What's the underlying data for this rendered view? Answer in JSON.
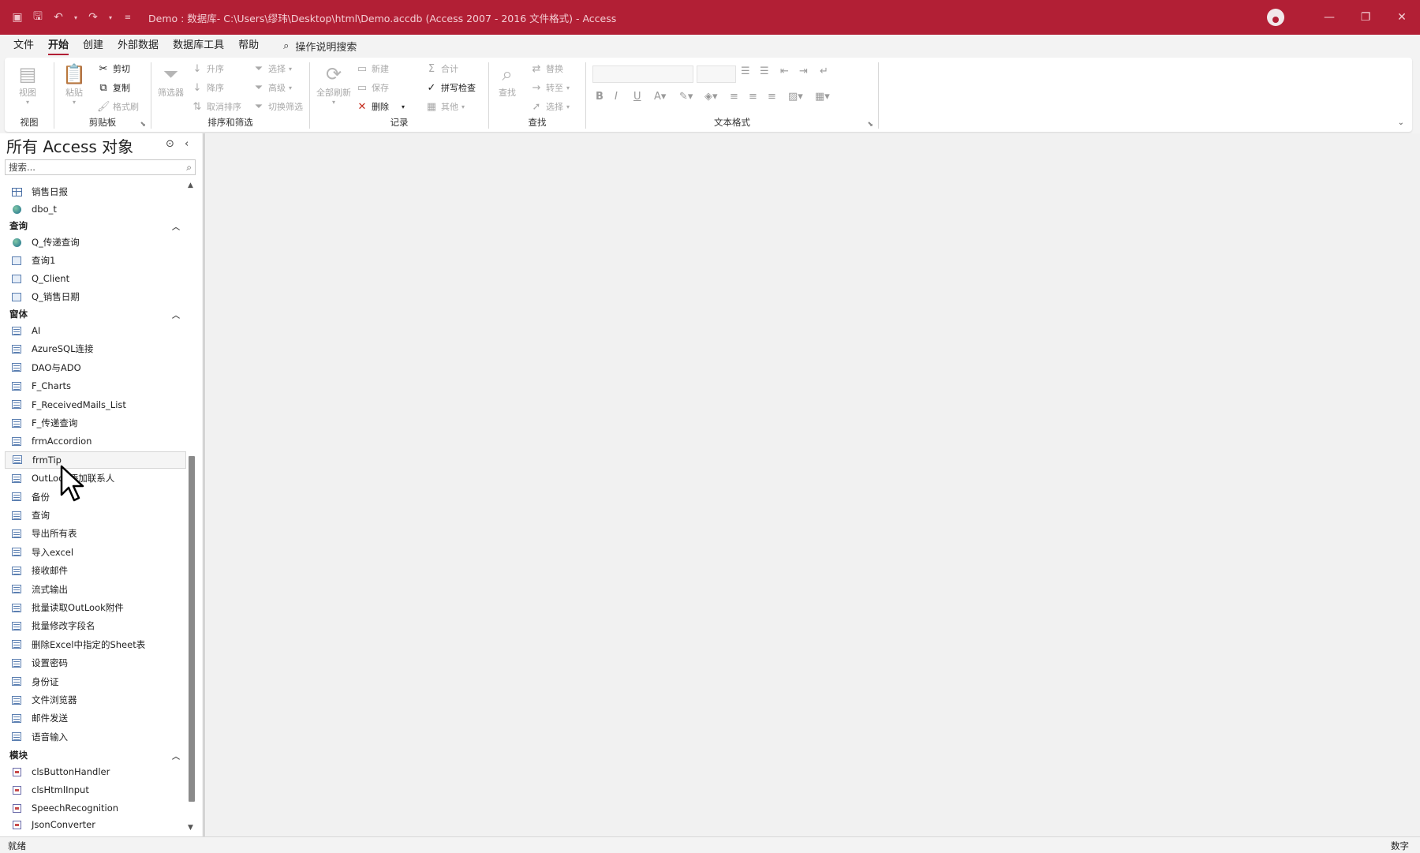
{
  "window": {
    "title": "Demo : 数据库- C:\\Users\\缪玮\\Desktop\\html\\Demo.accdb (Access 2007 - 2016 文件格式)  -  Access",
    "colors": {
      "title_bar": "#b21f35",
      "accent": "#b21f35"
    }
  },
  "menu": {
    "items": [
      "文件",
      "开始",
      "创建",
      "外部数据",
      "数据库工具",
      "帮助"
    ],
    "active": "开始",
    "tell_me": "操作说明搜索"
  },
  "ribbon": {
    "view": {
      "label": "视图",
      "group": "视图"
    },
    "clipboard": {
      "paste": "粘贴",
      "cut": "剪切",
      "copy": "复制",
      "format_painter": "格式刷",
      "group": "剪贴板"
    },
    "sort_filter": {
      "filter": "筛选器",
      "ascending": "升序",
      "descending": "降序",
      "remove_sort": "取消排序",
      "selection": "选择",
      "advanced": "高级",
      "toggle_filter": "切换筛选",
      "group": "排序和筛选"
    },
    "records": {
      "refresh_all": "全部刷新",
      "new": "新建",
      "save": "保存",
      "delete": "删除",
      "totals": "合计",
      "spelling": "拼写检查",
      "more": "其他",
      "group": "记录"
    },
    "find": {
      "find": "查找",
      "replace": "替换",
      "goto": "转至",
      "select": "选择",
      "group": "查找"
    },
    "text_format": {
      "group": "文本格式"
    }
  },
  "nav": {
    "title": "所有 Access 对象",
    "search_placeholder": "搜索...",
    "top_items": [
      {
        "label": "销售日报",
        "icon": "table-icon"
      },
      {
        "label": "dbo_t",
        "icon": "linked-table-icon"
      }
    ],
    "queries": {
      "header": "查询",
      "items": [
        {
          "label": "Q_传递查询",
          "icon": "passthrough-query-icon"
        },
        {
          "label": "查询1",
          "icon": "query-icon"
        },
        {
          "label": "Q_Client",
          "icon": "query-icon"
        },
        {
          "label": "Q_销售日期",
          "icon": "query-icon"
        }
      ]
    },
    "forms": {
      "header": "窗体",
      "items": [
        {
          "label": "AI"
        },
        {
          "label": "AzureSQL连接"
        },
        {
          "label": "DAO与ADO"
        },
        {
          "label": "F_Charts"
        },
        {
          "label": "F_ReceivedMails_List"
        },
        {
          "label": "F_传递查询"
        },
        {
          "label": "frmAccordion"
        },
        {
          "label": "frmTip"
        },
        {
          "label": "OutLook添加联系人"
        },
        {
          "label": "备份"
        },
        {
          "label": "查询"
        },
        {
          "label": "导出所有表"
        },
        {
          "label": "导入excel"
        },
        {
          "label": "接收邮件"
        },
        {
          "label": "流式输出"
        },
        {
          "label": "批量读取OutLook附件"
        },
        {
          "label": "批量修改字段名"
        },
        {
          "label": "删除Excel中指定的Sheet表"
        },
        {
          "label": "设置密码"
        },
        {
          "label": "身份证"
        },
        {
          "label": "文件浏览器"
        },
        {
          "label": "邮件发送"
        },
        {
          "label": "语音输入"
        }
      ],
      "selected": "frmTip"
    },
    "modules": {
      "header": "模块",
      "items": [
        {
          "label": "clsButtonHandler"
        },
        {
          "label": "clsHtmlInput"
        },
        {
          "label": "SpeechRecognition"
        },
        {
          "label": "JsonConverter"
        }
      ]
    }
  },
  "status": {
    "left": "就绪",
    "right": "数字"
  }
}
